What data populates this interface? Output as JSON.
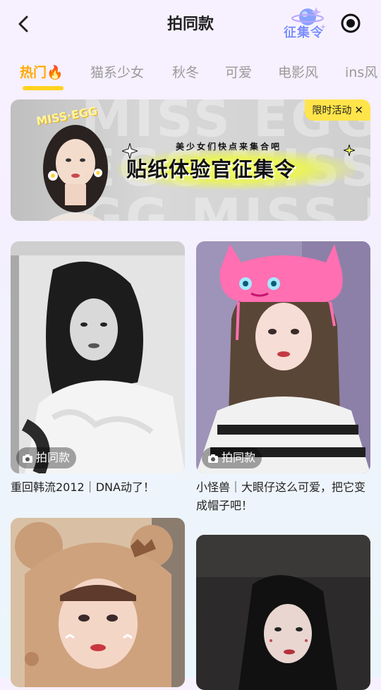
{
  "header": {
    "title": "拍同款",
    "event_logo_text": "征集令"
  },
  "tabs": [
    {
      "label": "热门🔥",
      "active": true
    },
    {
      "label": "猫系少女",
      "active": false
    },
    {
      "label": "秋冬",
      "active": false
    },
    {
      "label": "可爱",
      "active": false
    },
    {
      "label": "电影风",
      "active": false
    },
    {
      "label": "ins风",
      "active": false
    }
  ],
  "banner": {
    "background_text": "MISS EGG MISS\nEGG MISS EGG\nGG MISS EGG",
    "brand_sticker": "MISS·EGG",
    "tagline": "美少女们快点来集合吧",
    "slogan": "贴纸体验官征集令",
    "limited_badge": "限时活动",
    "close_glyph": "✕",
    "accent_color": "#ffe44a"
  },
  "cards": [
    {
      "pill": "拍同款",
      "caption": "重回韩流2012｜DNA动了！"
    },
    {
      "pill": "拍同款",
      "caption": "小怪兽｜大眼仔这么可爱，把它变成帽子吧！"
    },
    {
      "pill": "",
      "caption": ""
    },
    {
      "pill": "",
      "caption": ""
    }
  ],
  "colors": {
    "active_tab": "#ffaa00",
    "indicator": "#ffd21e",
    "inactive_tab": "#9a9a9a"
  }
}
